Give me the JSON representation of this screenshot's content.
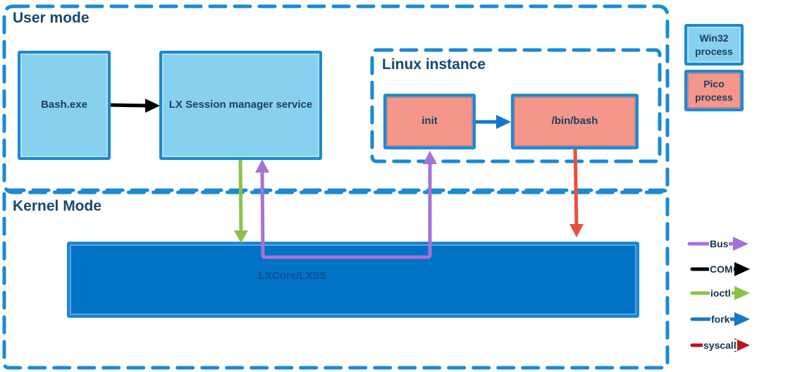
{
  "regions": {
    "user_mode": "User mode",
    "kernel_mode": "Kernel Mode",
    "linux_instance": "Linux instance"
  },
  "processes": {
    "bash_exe": "Bash.exe",
    "lx_session_manager": "LX Session manager service",
    "init": "init",
    "bin_bash": "/bin/bash",
    "lxcore": "LXCore/LXSS"
  },
  "legend": {
    "process_types": [
      {
        "label": "Win32\nprocess",
        "color": "#87d0f0"
      },
      {
        "label": "Pico\nprocess",
        "color": "#f4978a"
      }
    ],
    "arrow_types": [
      {
        "label": "Bus",
        "color": "#a872d6"
      },
      {
        "label": "COM",
        "color": "#000000"
      },
      {
        "label": "ioctl",
        "color": "#8bc34a"
      },
      {
        "label": "fork",
        "color": "#1478c8"
      },
      {
        "label": "syscall",
        "color": "#c0121c"
      }
    ]
  },
  "connections": [
    {
      "from": "Bash.exe",
      "to": "LX Session manager service",
      "type": "COM"
    },
    {
      "from": "init",
      "to": "/bin/bash",
      "type": "fork"
    },
    {
      "from": "LX Session manager service",
      "to": "LXCore/LXSS",
      "type": "ioctl"
    },
    {
      "from": "LXCore/LXSS",
      "to": "LX Session manager service",
      "type": "Bus"
    },
    {
      "from": "LXCore/LXSS",
      "to": "init",
      "type": "Bus"
    },
    {
      "from": "/bin/bash",
      "to": "LXCore/LXSS",
      "type": "syscall"
    }
  ],
  "colors": {
    "dash_border": "#1a8ad4",
    "title_text": "#17486e",
    "win32_fill": "#87d0f0",
    "pico_fill": "#f4978a",
    "kernel_fill": "#0072c6",
    "syscall_diagram": "#e8503e"
  }
}
